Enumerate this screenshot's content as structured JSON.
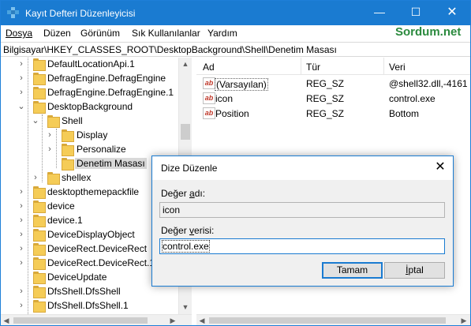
{
  "window": {
    "title": "Kayıt Defteri Düzenleyicisi",
    "controls": {
      "minimize": "—",
      "maximize": "☐",
      "close": "✕"
    }
  },
  "brand": "Sordum.net",
  "menu": [
    {
      "label": "Dosya"
    },
    {
      "label": "Düzen"
    },
    {
      "label": "Görünüm"
    },
    {
      "label": "Sık Kullanılanlar"
    },
    {
      "label": "Yardım"
    }
  ],
  "address": "Bilgisayar\\HKEY_CLASSES_ROOT\\DesktopBackground\\Shell\\Denetim Masası",
  "tree": {
    "items": [
      {
        "label": "DefaultLocationApi.1"
      },
      {
        "label": "DefragEngine.DefragEngine"
      },
      {
        "label": "DefragEngine.DefragEngine.1"
      },
      {
        "label": "DesktopBackground"
      },
      {
        "label": "Shell"
      },
      {
        "label": "Display"
      },
      {
        "label": "Personalize"
      },
      {
        "label": "Denetim Masası"
      },
      {
        "label": "shellex"
      },
      {
        "label": "desktopthemepackfile"
      },
      {
        "label": "device"
      },
      {
        "label": "device.1"
      },
      {
        "label": "DeviceDisplayObject"
      },
      {
        "label": "DeviceRect.DeviceRect"
      },
      {
        "label": "DeviceRect.DeviceRect.1"
      },
      {
        "label": "DeviceUpdate"
      },
      {
        "label": "DfsShell.DfsShell"
      },
      {
        "label": "DfsShell.DfsShell.1"
      }
    ]
  },
  "list": {
    "columns": [
      "Ad",
      "Tür",
      "Veri"
    ],
    "rows": [
      {
        "icon": "ab",
        "name": "(Varsayılan)",
        "type": "REG_SZ",
        "data": "@shell32.dll,-4161"
      },
      {
        "icon": "ab",
        "name": "icon",
        "type": "REG_SZ",
        "data": "control.exe"
      },
      {
        "icon": "ab",
        "name": "Position",
        "type": "REG_SZ",
        "data": "Bottom"
      }
    ]
  },
  "dialog": {
    "title": "Dize Düzenle",
    "close": "✕",
    "name_label_pre": "Değer ",
    "name_label_ul": "a",
    "name_label_post": "dı:",
    "name_value": "icon",
    "data_label_pre": "Değer ",
    "data_label_ul": "v",
    "data_label_post": "erisi:",
    "data_value": "control.exe",
    "ok_label": "Tamam",
    "cancel_label_ul": "İ",
    "cancel_label_post": "ptal"
  }
}
